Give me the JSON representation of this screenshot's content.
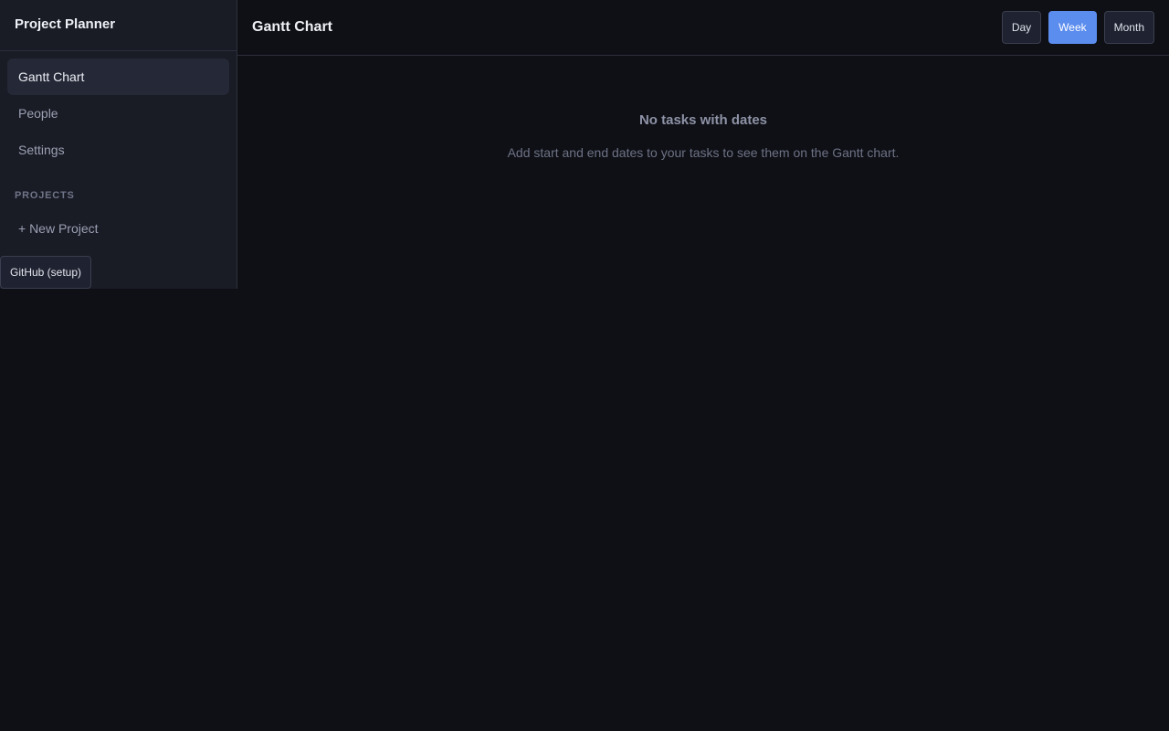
{
  "app": {
    "title": "Project Planner"
  },
  "sidebar": {
    "nav": [
      {
        "label": "Gantt Chart",
        "active": true
      },
      {
        "label": "People",
        "active": false
      },
      {
        "label": "Settings",
        "active": false
      }
    ],
    "projects_label": "PROJECTS",
    "new_project_label": "+ New Project",
    "github_label": "GitHub (setup)"
  },
  "main": {
    "title": "Gantt Chart",
    "view_options": [
      {
        "label": "Day",
        "selected": false
      },
      {
        "label": "Week",
        "selected": true
      },
      {
        "label": "Month",
        "selected": false
      }
    ],
    "empty_state": {
      "title": "No tasks with dates",
      "description": "Add start and end dates to your tasks to see them on the Gantt chart."
    }
  },
  "colors": {
    "background": "#0f1015",
    "sidebar": "#191b25",
    "accent": "#5b8def"
  }
}
